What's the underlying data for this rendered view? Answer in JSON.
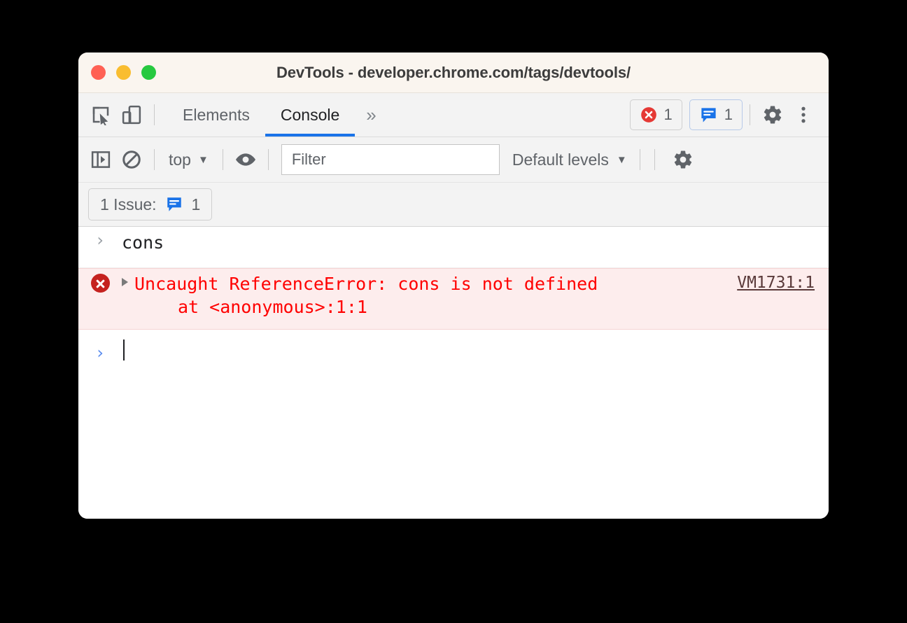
{
  "window": {
    "title": "DevTools - developer.chrome.com/tags/devtools/",
    "traffic_lights": [
      {
        "name": "close",
        "color": "#ff6154"
      },
      {
        "name": "minimize",
        "color": "#f9bd30"
      },
      {
        "name": "zoom",
        "color": "#26c940"
      }
    ]
  },
  "toolbar": {
    "inspect_icon": "inspect-element-icon",
    "device_icon": "device-toolbar-icon",
    "tabs": [
      {
        "label": "Elements",
        "active": false
      },
      {
        "label": "Console",
        "active": true
      }
    ],
    "more_tabs_label": "»",
    "errors_badge": {
      "icon": "error-circle-icon",
      "count": "1"
    },
    "issues_badge": {
      "icon": "issue-speech-bubble-icon",
      "count": "1"
    },
    "settings_icon": "gear-icon",
    "more_options_icon": "three-dot-menu-icon"
  },
  "console_toolbar": {
    "sidebar_icon": "console-sidebar-icon",
    "clear_icon": "clear-console-icon",
    "context": {
      "label": "top",
      "caret": "▼"
    },
    "eye_icon": "live-expression-eye-icon",
    "filter": {
      "placeholder": "Filter",
      "value": ""
    },
    "levels": {
      "label": "Default levels",
      "caret": "▼"
    },
    "settings_icon": "console-settings-gear-icon"
  },
  "issues_bar": {
    "chip_label": "1 Issue:",
    "chip_icon": "issue-speech-bubble-icon",
    "chip_count": "1"
  },
  "console": {
    "entries": [
      {
        "type": "input",
        "chevron": "›",
        "text": "cons"
      },
      {
        "type": "error",
        "icon": "error-circle-icon",
        "disclosure": "▸",
        "message": "Uncaught ReferenceError: cons is not defined",
        "stack": "at <anonymous>:1:1",
        "source_link": "VM1731:1"
      },
      {
        "type": "prompt",
        "chevron": "›",
        "text": ""
      }
    ]
  },
  "colors": {
    "accent": "#1a73e8",
    "error_text": "#ff0000",
    "error_bg": "#fdeded",
    "error_icon": "#c5221f",
    "issue_blue": "#1a73e8",
    "titlebar_bg": "#faf5ef",
    "toolbar_bg": "#f3f3f3"
  }
}
